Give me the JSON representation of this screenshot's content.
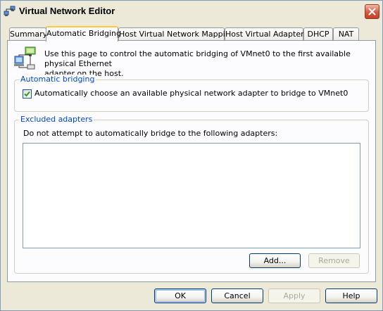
{
  "window": {
    "title": "Virtual Network Editor"
  },
  "tabs": [
    {
      "label": "Summary",
      "active": false
    },
    {
      "label": "Automatic Bridging",
      "active": true
    },
    {
      "label": "Host Virtual Network Mapping",
      "active": false
    },
    {
      "label": "Host Virtual Adapters",
      "active": false
    },
    {
      "label": "DHCP",
      "active": false
    },
    {
      "label": "NAT",
      "active": false
    }
  ],
  "page": {
    "intro_line1": "Use this page to control the automatic bridging of VMnet0 to the first available physical Ethernet",
    "intro_line2": "adapter on the host."
  },
  "automatic_bridging": {
    "legend": "Automatic bridging",
    "checkbox_label": "Automatically choose an available physical network adapter to bridge to VMnet0",
    "checked": true
  },
  "excluded_adapters": {
    "legend": "Excluded adapters",
    "description": "Do not attempt to automatically bridge to the following adapters:",
    "items": [],
    "add_label": "Add...",
    "remove_label": "Remove"
  },
  "footer": {
    "ok_label": "OK",
    "cancel_label": "Cancel",
    "apply_label": "Apply",
    "help_label": "Help"
  },
  "icons": {
    "app": "network-editor-icon",
    "close": "close-icon",
    "page": "network-bridge-icon",
    "check": "checkmark-icon"
  },
  "colors": {
    "window_bg": "#ECE9D8",
    "panel_bg": "#FCFCFE",
    "legend_text": "#0046D5",
    "active_tab_accent": "#FFC83C",
    "close_button": "#D4593F"
  }
}
